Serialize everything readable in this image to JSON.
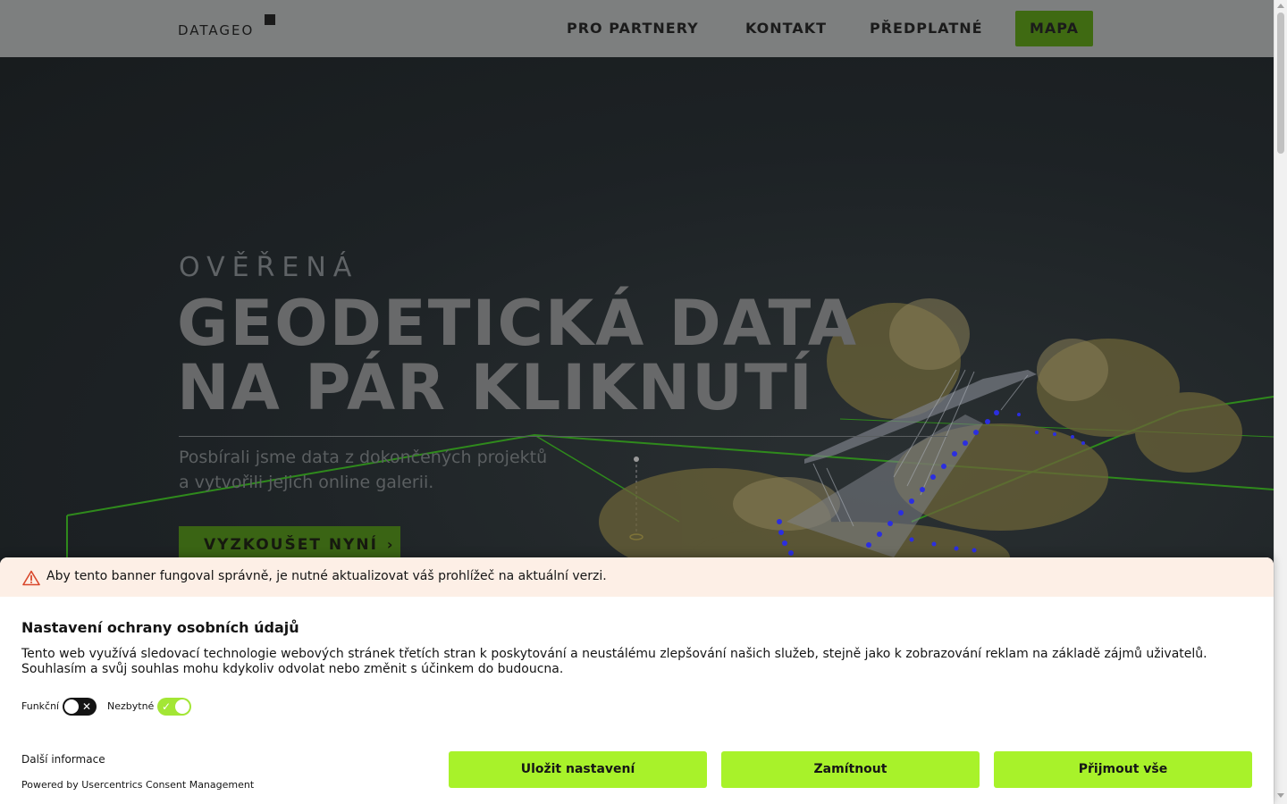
{
  "header": {
    "logo_text": "DATAGEO",
    "nav": [
      {
        "label": "PRO PARTNERY"
      },
      {
        "label": "KONTAKT"
      },
      {
        "label": "PŘEDPLATNÉ"
      },
      {
        "label": "MAPA"
      }
    ]
  },
  "hero": {
    "eyebrow": "OVĚŘENÁ",
    "title_line1": "GEODETICKÁ DATA",
    "title_line2": "NA PÁR KLIKNUTÍ",
    "subtitle_line1": "Posbírali jsme data z dokončených projektů",
    "subtitle_line2": "a vytvořili jejich online galerii.",
    "cta_label": "VYZKOUŠET NYNÍ",
    "cta_icon": "chevron-right-icon"
  },
  "consent": {
    "warning": "Aby tento banner fungoval správně, je nutné aktualizovat váš prohlížeč na aktuální verzi.",
    "warning_icon": "warning-triangle-icon",
    "title": "Nastavení ochrany osobních údajů",
    "description": "Tento web využívá sledovací technologie webových stránek třetích stran k poskytování a neustálému zlepšování našich služeb, stejně jako k zobrazování reklam na základě zájmů uživatelů. Souhlasím a svůj souhlas mohu kdykoliv odvolat nebo změnit s účinkem do budoucna.",
    "toggles": [
      {
        "label": "Funkční",
        "state": "off",
        "mark": "✕"
      },
      {
        "label": "Nezbytné",
        "state": "on",
        "mark": "✓"
      }
    ],
    "more_info": "Další informace",
    "powered_by": "Powered by Usercentrics Consent Management",
    "buttons": {
      "save": "Uložit nastavení",
      "deny": "Zamítnout",
      "accept": "Přijmout vše"
    }
  },
  "colors": {
    "accent_green": "#a8f22a",
    "nav_cta_bg": "#3f6a12",
    "warning_bg": "#fdefe6",
    "warning_icon": "#d9472b"
  }
}
